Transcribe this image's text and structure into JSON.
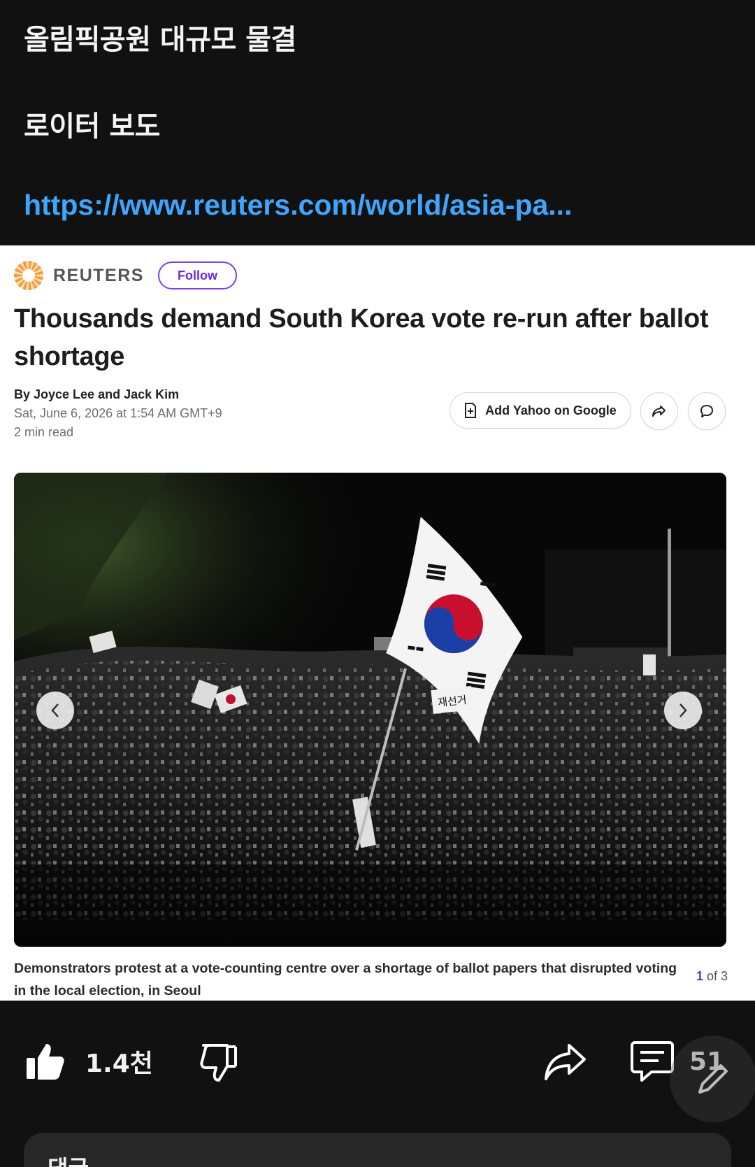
{
  "post": {
    "line1": "올림픽공원 대규모 물결",
    "line2": "로이터 보도",
    "link": "https://www.reuters.com/world/asia-pa..."
  },
  "article": {
    "source": "REUTERS",
    "follow_label": "Follow",
    "headline": "Thousands demand South Korea vote re-run after ballot shortage",
    "byline": "By Joyce Lee and Jack Kim",
    "date": "Sat, June 6, 2026 at 1:54 AM GMT+9",
    "read_time": "2 min read",
    "add_source_label": "Add Yahoo on Google",
    "photo_sign_text": "재선거",
    "caption": "Demonstrators protest at a vote-counting centre over a shortage of ballot papers that disrupted voting in the local election, in Seoul",
    "counter_current": "1",
    "counter_rest": " of 3"
  },
  "actions": {
    "like_count": "1.4천",
    "comment_count": "51"
  },
  "comments": {
    "title": "댓글"
  },
  "colors": {
    "background": "#111111",
    "link": "#3ea6ff",
    "follow_accent": "#6a2bd9",
    "card": "#272727"
  },
  "icons": [
    "thumbs-up-icon",
    "thumbs-down-icon",
    "share-icon",
    "comment-icon",
    "edit-pencil-icon",
    "bookmark-add-icon",
    "chevron-left-icon",
    "chevron-right-icon"
  ]
}
